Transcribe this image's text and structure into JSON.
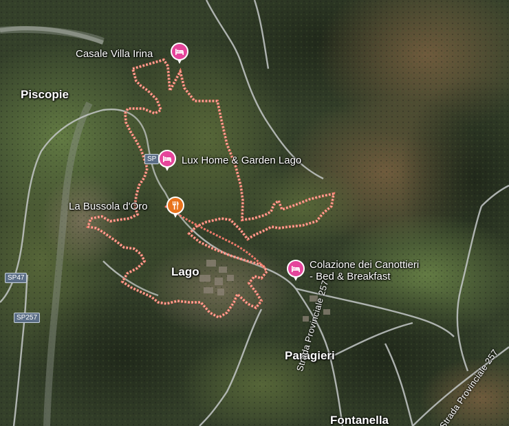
{
  "map": {
    "type": "satellite",
    "boundary_color": "#f07a6a"
  },
  "places": {
    "piscopie": "Piscopie",
    "lago": "Lago",
    "paragieri": "Paragieri",
    "fontanella": "Fontanella"
  },
  "pois": {
    "casale": {
      "label": "Casale Villa Irina",
      "icon": "hotel-bed-icon"
    },
    "lux": {
      "label": "Lux Home & Garden Lago",
      "icon": "hotel-bed-icon"
    },
    "bussola": {
      "label": "La Bussola d'Oro",
      "icon": "fork-knife-icon"
    },
    "colazione": {
      "line1": "Colazione dei Canottieri",
      "line2": "- Bed & Breakfast",
      "icon": "hotel-bed-icon"
    }
  },
  "roads": {
    "sp47": "SP47",
    "sp257": "SP257",
    "sp_partial": "SP",
    "provinciale_a": "Strada Provinciale 257",
    "provinciale_b": "Strada Provinciale 257"
  },
  "colors": {
    "hotel_pin": "#e5459b",
    "food_pin": "#e8731c",
    "road_shield": "#5b6e86"
  }
}
